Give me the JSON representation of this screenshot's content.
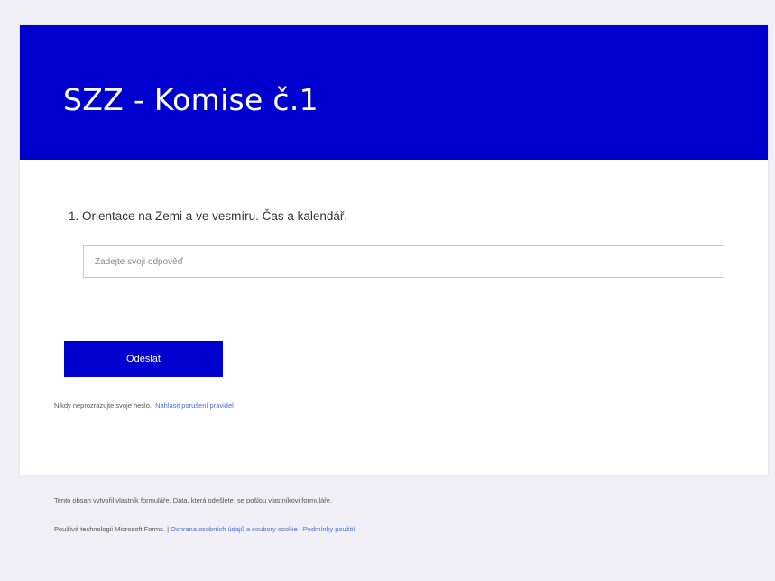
{
  "form": {
    "title": "SZZ - Komise č.1",
    "header_color": "#0000ce",
    "question": "1. Orientace na Zemi a ve vesmíru. Čas a kalendář.",
    "answer_placeholder": "Zadejte svoji odpověď",
    "answer_value": "",
    "submit_label": "Odeslat",
    "password_warning": "Nikdy neprozrazujte svoje heslo.",
    "report_link": "Nahlásit porušení pravidel"
  },
  "footer": {
    "disclaimer": "Tento obsah vytvořil vlastník formuláře. Data, která odešlete, se pošlou vlastníkovi formuláře.",
    "powered_by": "Používá technologii Microsoft Forms.",
    "separator": "|",
    "privacy_link": "Ochrana osobních údajů a soubory cookie",
    "terms_link": "Podmínky použití"
  }
}
